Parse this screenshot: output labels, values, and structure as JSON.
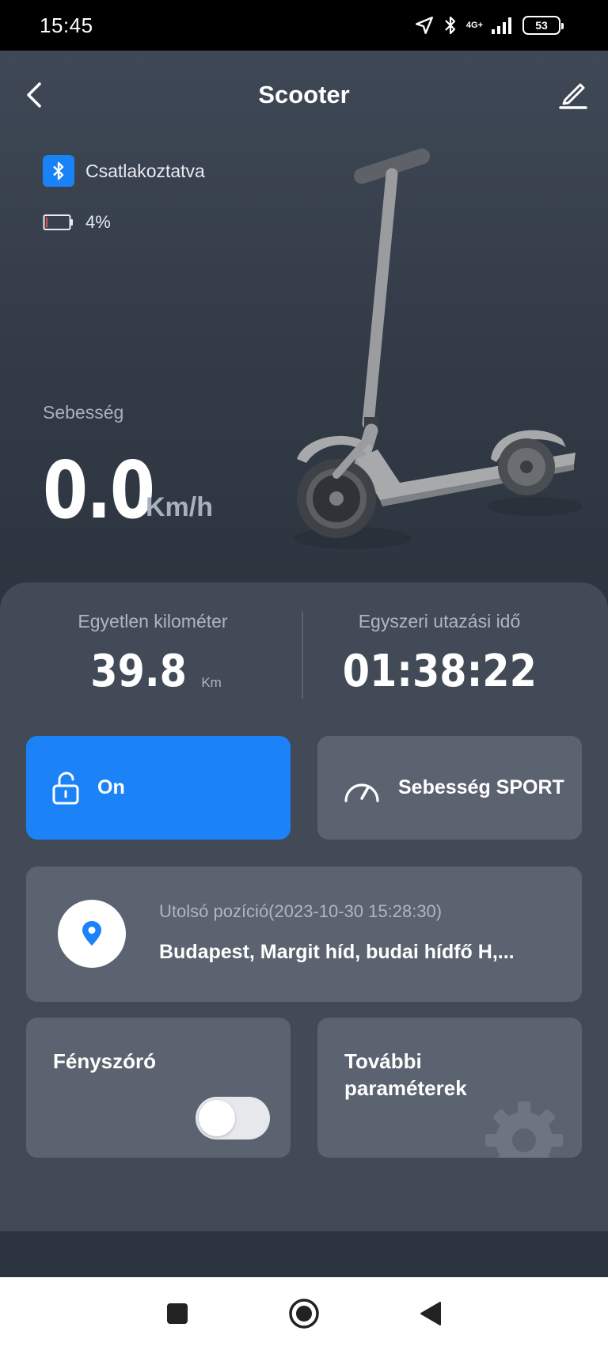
{
  "status_bar": {
    "time": "15:45",
    "network": "4G+",
    "battery": "53"
  },
  "header": {
    "title": "Scooter"
  },
  "connection": {
    "label": "Csatlakoztatva",
    "battery_percent": "4%",
    "battery_level": 0.04
  },
  "speed": {
    "label": "Sebesség",
    "value": "0.0",
    "unit": "Km/h"
  },
  "stats": {
    "distance_label": "Egyetlen kilométer",
    "distance_value": "39.8",
    "distance_unit": "Km",
    "time_label": "Egyszeri utazási idő",
    "time_value": "01:38:22"
  },
  "lock": {
    "label": "On"
  },
  "mode": {
    "label": "Sebesség SPORT"
  },
  "location": {
    "title": "Utolsó pozíció(2023-10-30 15:28:30)",
    "address": "Budapest, Margit híd, budai hídfő H,..."
  },
  "headlight": {
    "label": "Fényszóró",
    "enabled": false
  },
  "params": {
    "label": "További paraméterek"
  },
  "colors": {
    "accent": "#1b82f8",
    "background": "#2c3440",
    "card": "#5a636f",
    "battery_low": "#e24b4b"
  }
}
